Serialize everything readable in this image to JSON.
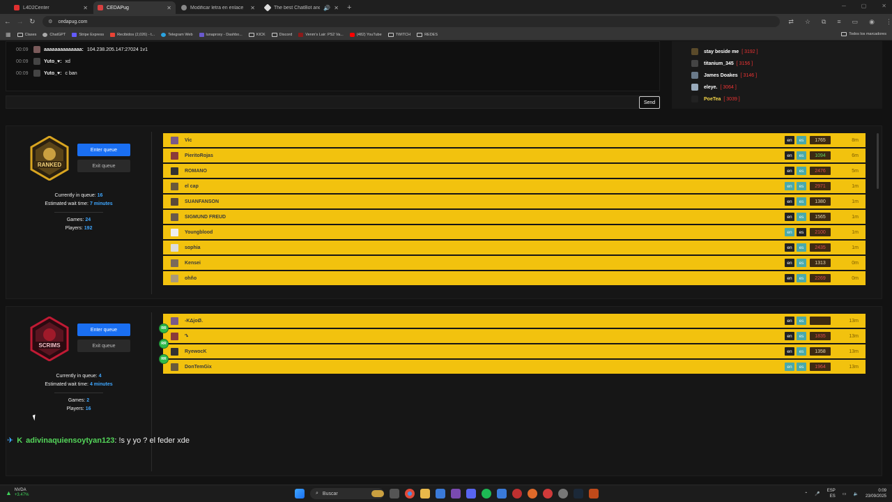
{
  "browser": {
    "tabs": [
      {
        "label": "L4D2Center",
        "color": "#e03030",
        "active": false
      },
      {
        "label": "CEDAPug",
        "color": "#d84040",
        "active": true
      },
      {
        "label": "Modificar letra en enlace",
        "color": "#888888",
        "active": false
      },
      {
        "label": "The best ChatBot and Wid...",
        "color": "#dddddd",
        "active": false
      }
    ],
    "url": "cedapug.com",
    "bookmarks": [
      {
        "label": "Clases",
        "icon": "folder-icon"
      },
      {
        "label": "ChatGPT",
        "icon": "chatgpt-icon"
      },
      {
        "label": "Stripe Express",
        "icon": "stripe-icon"
      },
      {
        "label": "Recibidos (2,026) - t...",
        "icon": "gmail-icon"
      },
      {
        "label": "Telegram Web",
        "icon": "telegram-icon"
      },
      {
        "label": "lunaproxy - Dashbo...",
        "icon": "lunaproxy-icon"
      },
      {
        "label": "KICK",
        "icon": "folder-icon"
      },
      {
        "label": "Discord",
        "icon": "folder-icon"
      },
      {
        "label": "Venm's Lair: PS2 Va...",
        "icon": "venm-icon"
      },
      {
        "label": "(482) YouTube",
        "icon": "youtube-icon"
      },
      {
        "label": "TWITCH",
        "icon": "folder-icon"
      },
      {
        "label": "REDES",
        "icon": "folder-icon"
      }
    ],
    "all_bookmarks": "Todos los marcadores"
  },
  "chat": {
    "messages": [
      {
        "time": "00:09",
        "name": "aaaaaaaaaaaaaa:",
        "text": "104.238.205.147:27024 1v1"
      },
      {
        "time": "00:09",
        "name": "Yuto_♥:",
        "text": "xd"
      },
      {
        "time": "00:09",
        "name": "Yuto_♥:",
        "text": "c ban"
      }
    ],
    "send_label": "Send"
  },
  "ranking": [
    {
      "name": "stay beside me",
      "points": "[ 3192 ]"
    },
    {
      "name": "titanium_345",
      "points": "[ 3156 ]"
    },
    {
      "name": "James Doakes",
      "points": "[ 3146 ]"
    },
    {
      "name": "eleye.",
      "points": "[ 3064 ]"
    },
    {
      "name": "PoeTea",
      "points": "[ 3039 ]"
    }
  ],
  "ranked": {
    "badge_text": "RANKED",
    "enter_label": "Enter queue",
    "exit_label": "Exit queue",
    "queue_label": "Currently in queue:",
    "queue_count": "16",
    "wait_label": "Estimated wait time:",
    "wait_value": "7 minutes",
    "games_label": "Games:",
    "games_value": "24",
    "players_label": "Players:",
    "players_value": "192",
    "players": [
      {
        "name": "Vic",
        "en": "dark",
        "es": "teal",
        "pts": "1765",
        "pts_color": "#e8d8b0",
        "wait": "8m"
      },
      {
        "name": "PieritoRojas",
        "en": "dark",
        "es": "teal",
        "pts": "1094",
        "pts_color": "#5fd35f",
        "wait": "6m"
      },
      {
        "name": "ROMANO",
        "en": "dark",
        "es": "teal",
        "pts": "2476",
        "pts_color": "#e05050",
        "wait": "5m"
      },
      {
        "name": "el cap",
        "en": "teal",
        "es": "teal",
        "pts": "2971",
        "pts_color": "#e05050",
        "wait": "1m"
      },
      {
        "name": "SUANFANSON",
        "en": "dark",
        "es": "teal",
        "pts": "1380",
        "pts_color": "#e8d8b0",
        "wait": "1m"
      },
      {
        "name": "SIGMUND FREUD",
        "en": "dark",
        "es": "teal",
        "pts": "1565",
        "pts_color": "#e8d8b0",
        "wait": "1m"
      },
      {
        "name": "Youngblood",
        "en": "teal",
        "es": "dark",
        "pts": "2100",
        "pts_color": "#e05050",
        "wait": "1m"
      },
      {
        "name": "sophia",
        "en": "dark",
        "es": "teal",
        "pts": "2435",
        "pts_color": "#e05050",
        "wait": "1m"
      },
      {
        "name": "Kensei",
        "en": "dark",
        "es": "teal",
        "pts": "1313",
        "pts_color": "#e8d8b0",
        "wait": "0m"
      },
      {
        "name": "ohño",
        "en": "dark",
        "es": "teal",
        "pts": "2269",
        "pts_color": "#e05050",
        "wait": "0m"
      }
    ]
  },
  "scrims": {
    "badge_text": "SCRIMS",
    "enter_label": "Enter queue",
    "exit_label": "Exit queue",
    "queue_label": "Currently in queue:",
    "queue_count": "4",
    "wait_label": "Estimated wait time:",
    "wait_value": "4 minutes",
    "games_label": "Games:",
    "games_value": "2",
    "players_label": "Players:",
    "players_value": "16",
    "players": [
      {
        "name": "-KΔjoØ.",
        "en": "dark",
        "es": "teal",
        "pts": "",
        "pts_color": "#e8d8b0",
        "wait": "13m"
      },
      {
        "name": "ኄ",
        "en": "dark",
        "es": "teal",
        "pts": "1835",
        "pts_color": "#e05050",
        "wait": "13m"
      },
      {
        "name": "RyewocK",
        "en": "dark",
        "es": "teal",
        "pts": "1358",
        "pts_color": "#e8d8b0",
        "wait": "13m"
      },
      {
        "name": "DonTemGix",
        "en": "teal",
        "es": "teal",
        "pts": "1964",
        "pts_color": "#e05050",
        "wait": "13m"
      }
    ]
  },
  "bottom_chat": {
    "name": "adivinaquiensoytyan123",
    "text": ": !s y yo ? el feder xde"
  },
  "taskbar": {
    "stock_name": "NVDA",
    "stock_change": "+3.47%",
    "search_label": "Buscar",
    "lang": "ESP",
    "lang_sub": "ES",
    "time": "0:09",
    "date": "23/09/2025"
  },
  "colors": {
    "queue_row": "#f2c20e",
    "enter_button": "#1a6ff2",
    "accent_blue": "#3fa7ff",
    "chat_green": "#54d65a"
  }
}
